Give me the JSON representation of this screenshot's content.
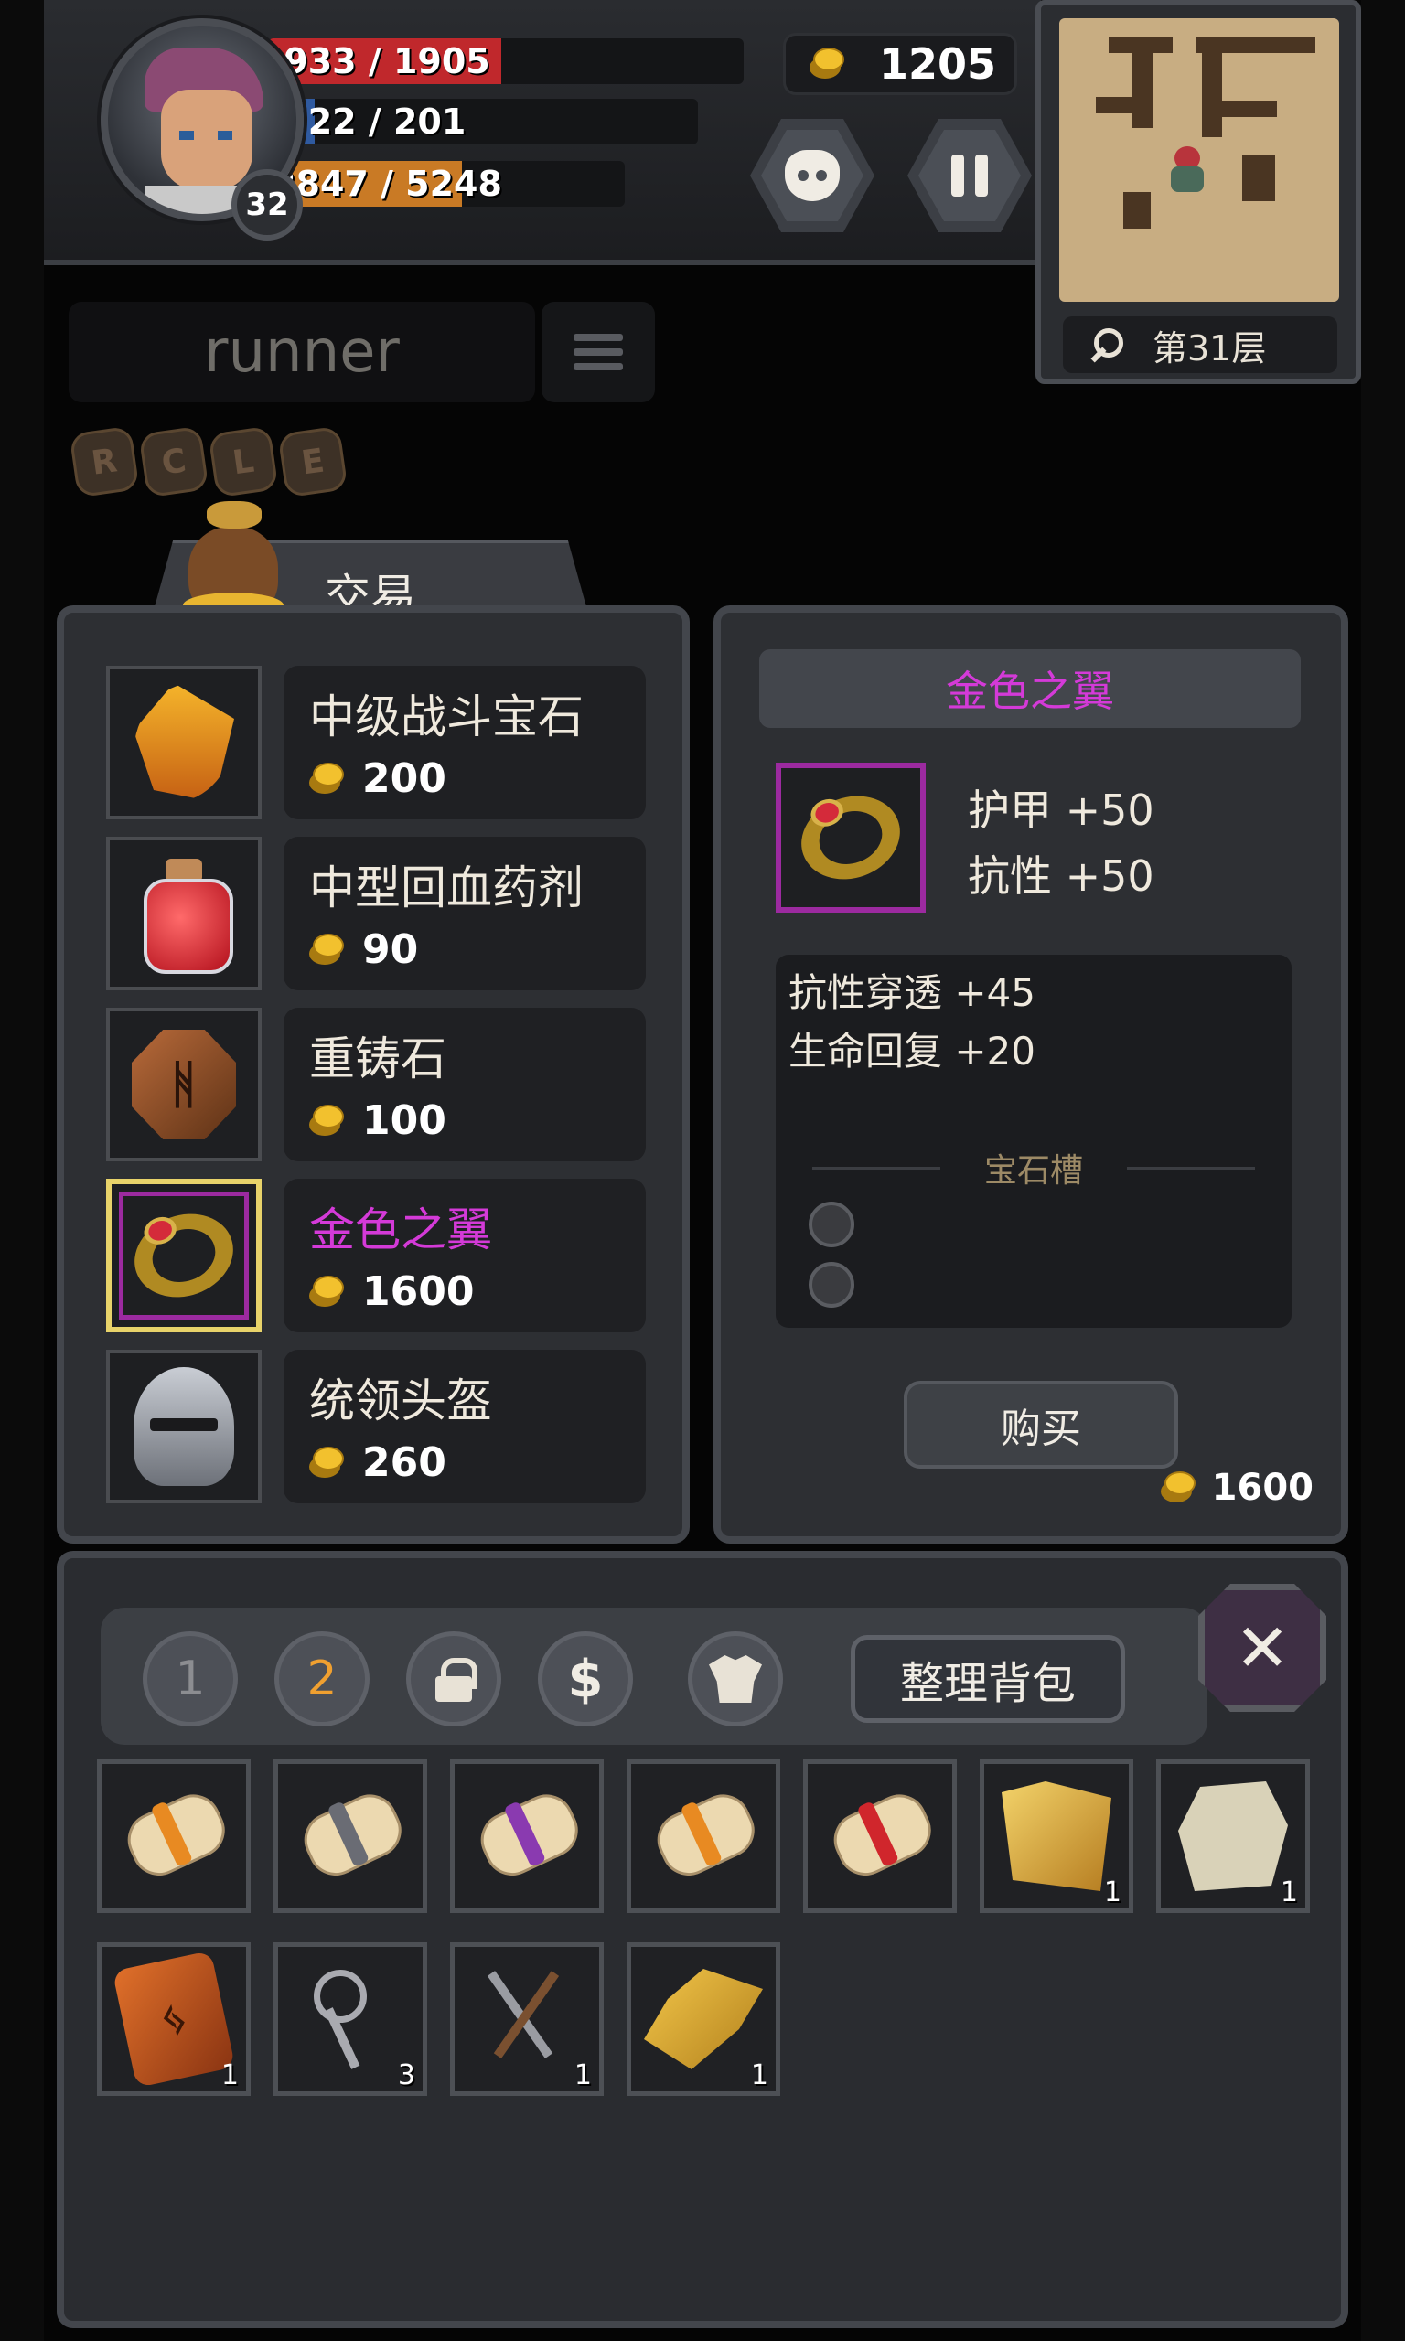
{
  "hud": {
    "level": "32",
    "hp": {
      "text": "933 / 1905",
      "current": 933,
      "max": 1905
    },
    "mp": {
      "text": "22 / 201",
      "current": 22,
      "max": 201
    },
    "xp": {
      "text": "2847 / 5248",
      "current": 2847,
      "max": 5248
    },
    "gold": "1205",
    "floor": "第31层"
  },
  "search": {
    "name": "runner"
  },
  "runes": [
    "R",
    "C",
    "L",
    "E"
  ],
  "trade": {
    "title": "交易"
  },
  "shop_items": [
    {
      "name": "中级战斗宝石",
      "price": "200",
      "icon": "gem-flame-icon",
      "rarity": "normal"
    },
    {
      "name": "中型回血药剂",
      "price": "90",
      "icon": "potion-icon",
      "rarity": "normal"
    },
    {
      "name": "重铸石",
      "price": "100",
      "icon": "rune-stone-icon",
      "rarity": "normal"
    },
    {
      "name": "金色之翼",
      "price": "1600",
      "icon": "ring-icon",
      "rarity": "epic",
      "selected": true
    },
    {
      "name": "统领头盔",
      "price": "260",
      "icon": "helmet-icon",
      "rarity": "normal"
    }
  ],
  "detail": {
    "title": "金色之翼",
    "stats": [
      "护甲 +50",
      "抗性 +50"
    ],
    "extra": [
      "抗性穿透 +45",
      "生命回复 +20"
    ],
    "gem_label": "宝石槽",
    "sockets": 2,
    "buy_label": "购买",
    "price": "1600"
  },
  "bag": {
    "tabs": [
      "1",
      "2"
    ],
    "active_tab": "2",
    "sort_label": "整理背包",
    "close_label": "✕",
    "items": [
      {
        "icon": "scroll-orange-icon",
        "count": ""
      },
      {
        "icon": "scroll-gray-icon",
        "count": ""
      },
      {
        "icon": "scroll-purple-icon",
        "count": ""
      },
      {
        "icon": "scroll-orange-icon",
        "count": ""
      },
      {
        "icon": "scroll-red-icon",
        "count": ""
      },
      {
        "icon": "map-scroll-icon",
        "count": "1"
      },
      {
        "icon": "stone-rune-icon",
        "count": "1"
      },
      {
        "icon": "rune-tablet-icon",
        "count": "1"
      },
      {
        "icon": "keys-icon",
        "count": "3"
      },
      {
        "icon": "lockpicks-icon",
        "count": "1"
      },
      {
        "icon": "feathers-icon",
        "count": "1"
      }
    ]
  },
  "colors": {
    "epic": "#d43ad8",
    "hp": "#c0282c",
    "mp": "#2f5aa0",
    "xp": "#c97a25",
    "gold": "#f2c12e"
  }
}
